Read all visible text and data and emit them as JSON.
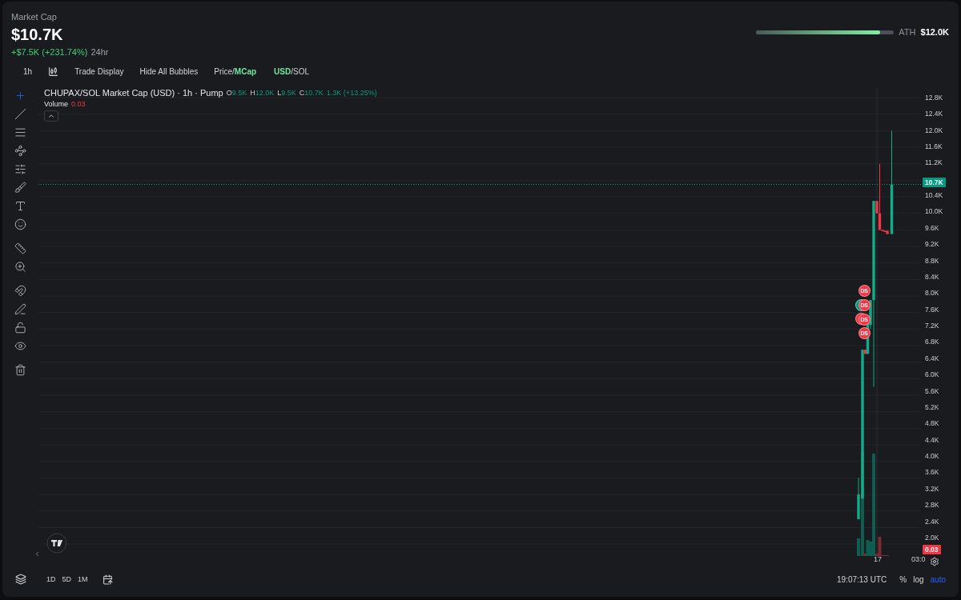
{
  "header": {
    "label": "Market Cap",
    "value": "$10.7K",
    "change": "+$7.5K (+231.74%)",
    "period": "24hr",
    "ath": {
      "label": "ATH",
      "value": "$12.0K",
      "level": 0.9
    }
  },
  "toolbar": {
    "interval": "1h",
    "buttons": [
      "Trade Display",
      "Hide All Bubbles"
    ],
    "toggles": [
      {
        "separator": "/",
        "options": [
          {
            "label": "Price",
            "selected": false
          },
          {
            "label": "MCap",
            "selected": true
          }
        ]
      },
      {
        "separator": "/",
        "options": [
          {
            "label": "USD",
            "selected": true
          },
          {
            "label": "SOL",
            "selected": false
          }
        ]
      }
    ]
  },
  "tools": [
    [
      {
        "kind": "crosshair",
        "selected": true
      },
      {
        "kind": "line",
        "selected": false
      },
      {
        "kind": "lines",
        "selected": false
      },
      {
        "kind": "pattern",
        "selected": false
      },
      {
        "kind": "sliders",
        "selected": false
      },
      {
        "kind": "brush",
        "selected": false
      },
      {
        "kind": "text",
        "selected": false
      },
      {
        "kind": "smile",
        "selected": false
      }
    ],
    [
      {
        "kind": "ruler",
        "selected": false
      },
      {
        "kind": "zoom",
        "selected": false
      }
    ],
    [
      {
        "kind": "magnet",
        "selected": false
      },
      {
        "kind": "pencil",
        "selected": false
      },
      {
        "kind": "lock",
        "selected": false
      },
      {
        "kind": "eye",
        "selected": false
      }
    ],
    [
      {
        "kind": "trash",
        "selected": false
      }
    ]
  ],
  "legend": {
    "title": "CHUPAX/SOL Market Cap (USD) · 1h · Pump",
    "ohlc": [
      {
        "key": "O",
        "value": "9.5K"
      },
      {
        "key": "H",
        "value": "12.0K"
      },
      {
        "key": "L",
        "value": "9.5K"
      },
      {
        "key": "C",
        "value": "10.7K"
      }
    ],
    "change": "1.3K (+13.25%)",
    "volume": {
      "label": "Volume",
      "value": "0.03"
    }
  },
  "bubbles": [
    {
      "color": "#089981"
    },
    {
      "color": "#f23645"
    },
    {
      "text": "DS",
      "color": "#f23645"
    },
    {
      "text": "DS",
      "color": "#f23645"
    },
    {
      "text": "DS",
      "color": "#f23645"
    },
    {
      "text": "DS",
      "color": "#f23645"
    }
  ],
  "y_axis": [
    {
      "kind": "tick",
      "label": "12.8K"
    },
    {
      "kind": "tick",
      "label": "12.4K"
    },
    {
      "kind": "tick",
      "label": "12.0K"
    },
    {
      "kind": "tick",
      "label": "11.6K"
    },
    {
      "kind": "tick",
      "label": "11.2K"
    },
    {
      "kind": "price",
      "label": "10.7K"
    },
    {
      "kind": "tick",
      "label": "10.4K"
    },
    {
      "kind": "tick",
      "label": "10.0K"
    },
    {
      "kind": "tick",
      "label": "9.6K"
    },
    {
      "kind": "tick",
      "label": "9.2K"
    },
    {
      "kind": "tick",
      "label": "8.8K"
    },
    {
      "kind": "tick",
      "label": "8.4K"
    },
    {
      "kind": "tick",
      "label": "8.0K"
    },
    {
      "kind": "tick",
      "label": "7.6K"
    },
    {
      "kind": "tick",
      "label": "7.2K"
    },
    {
      "kind": "tick",
      "label": "6.8K"
    },
    {
      "kind": "tick",
      "label": "6.4K"
    },
    {
      "kind": "tick",
      "label": "6.0K"
    },
    {
      "kind": "tick",
      "label": "5.6K"
    },
    {
      "kind": "tick",
      "label": "5.2K"
    },
    {
      "kind": "tick",
      "label": "4.8K"
    },
    {
      "kind": "tick",
      "label": "4.4K"
    },
    {
      "kind": "tick",
      "label": "4.0K"
    },
    {
      "kind": "tick",
      "label": "3.6K"
    },
    {
      "kind": "tick",
      "label": "3.2K"
    },
    {
      "kind": "tick",
      "label": "2.8K"
    },
    {
      "kind": "tick",
      "label": "2.4K"
    },
    {
      "kind": "tick",
      "label": "2.0K"
    },
    {
      "kind": "volume",
      "label": "0.03"
    }
  ],
  "time_axis": [
    "17",
    "03:0"
  ],
  "ranges": [
    "1D",
    "5D",
    "1M"
  ],
  "footer": {
    "time": "19:07:13 UTC",
    "scales": [
      {
        "label": "%",
        "selected": false
      },
      {
        "label": "log",
        "selected": false
      },
      {
        "label": "auto",
        "selected": true
      }
    ]
  }
}
